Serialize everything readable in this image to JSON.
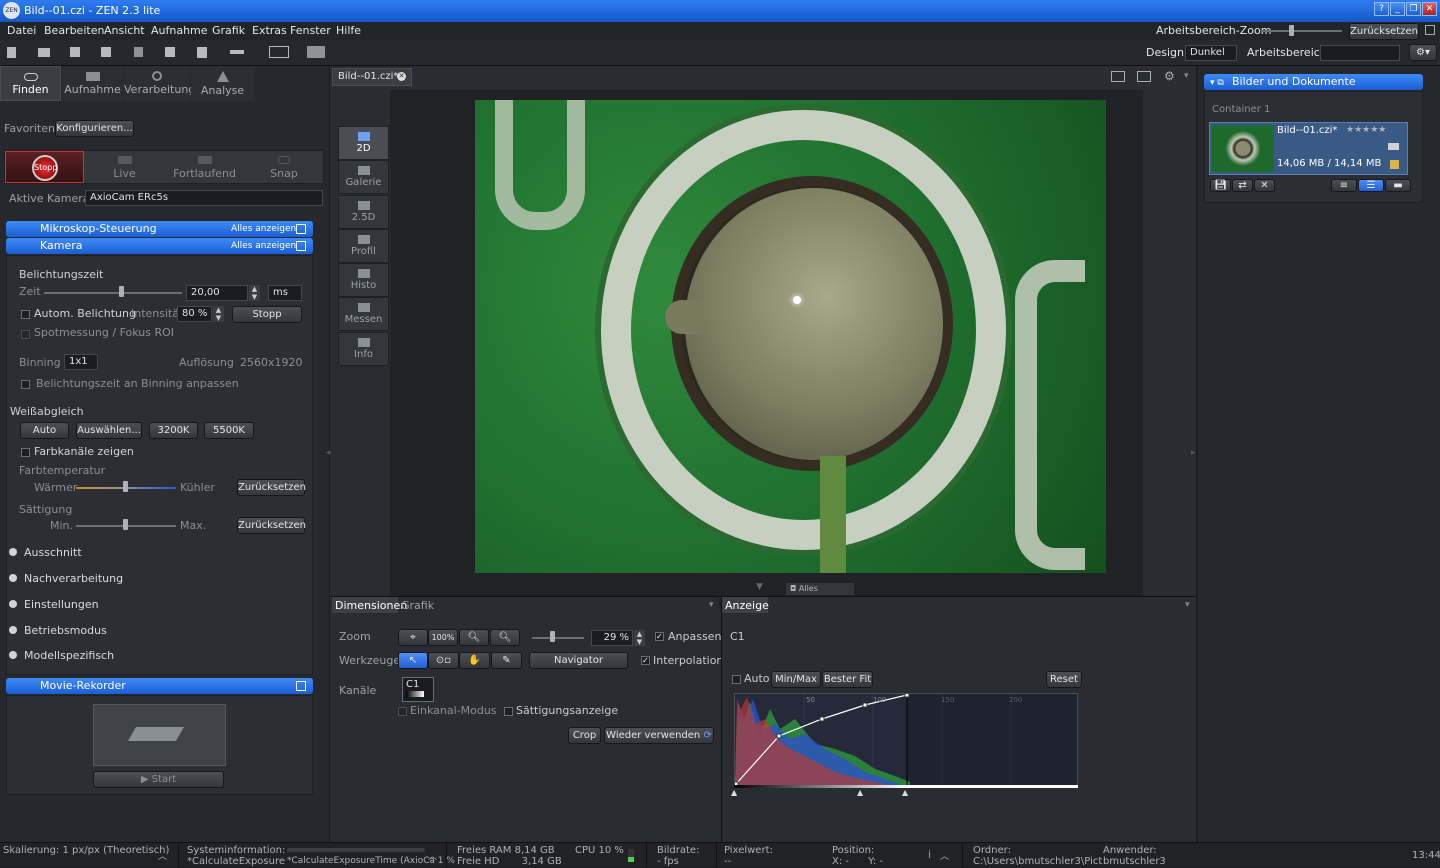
{
  "window": {
    "title": "Bild--01.czi - ZEN 2.3 lite"
  },
  "menu": [
    "Datei",
    "Bearbeiten",
    "Ansicht",
    "Aufnahme",
    "Grafik",
    "Extras",
    "Fenster",
    "Hilfe"
  ],
  "workspace": {
    "zoom_label": "Arbeitsbereich-Zoom",
    "reset": "Zurücksetzen",
    "design_label": "Design",
    "design_value": "Dunkel",
    "workspace_label": "Arbeitsbereich"
  },
  "tabs": [
    "Finden",
    "Aufnahme",
    "Verarbeitung",
    "Analyse"
  ],
  "favorites": {
    "label": "Favoriten",
    "configure": "Konfigurieren..."
  },
  "acquire": {
    "stop": "Stopp",
    "live": "Live",
    "continuous": "Fortlaufend",
    "snap": "Snap"
  },
  "camera_select": {
    "label": "Aktive Kamera",
    "value": "AxioCam ERc5s"
  },
  "sections": {
    "microscope": "Mikroskop-Steuerung",
    "camera": "Kamera",
    "show_all": "Alles anzeigen",
    "movie": "Movie-Rekorder"
  },
  "exposure": {
    "title": "Belichtungszeit",
    "time_label": "Zeit",
    "time_value": "20,00",
    "unit": "ms",
    "auto": "Autom. Belichtung",
    "intensity_label": "Intensität",
    "intensity_value": "80 %",
    "stop": "Stopp",
    "spot": "Spotmessung / Fokus ROI"
  },
  "binning": {
    "label": "Binning",
    "value": "1x1",
    "resolution_label": "Auflösung",
    "resolution_value": "2560x1920",
    "adapt": "Belichtungszeit an Binning anpassen"
  },
  "whitebalance": {
    "title": "Weißabgleich",
    "auto": "Auto",
    "choose": "Auswählen...",
    "k3200": "3200K",
    "k5500": "5500K",
    "show_channels": "Farbkanäle zeigen",
    "temp_label": "Farbtemperatur",
    "warmer": "Wärmer",
    "cooler": "Kühler",
    "reset": "Zurücksetzen",
    "saturation": "Sättigung",
    "min": "Min.",
    "max": "Max."
  },
  "collapsed": [
    "Ausschnitt",
    "Nachverarbeitung",
    "Einstellungen",
    "Betriebsmodus",
    "Modellspezifisch"
  ],
  "movie": {
    "start": "Start"
  },
  "doc_tab": "Bild--01.czi*",
  "view_tabs": [
    "2D",
    "Galerie",
    "2.5D",
    "Profil",
    "Histo",
    "Messen",
    "Info"
  ],
  "show_all_bottom": "Alles anzeigen",
  "dims": {
    "tab1": "Dimensionen",
    "tab2": "Grafik",
    "zoom": "Zoom",
    "zoom_100": "100%",
    "zoom_value": "29 %",
    "fit": "Anpassen",
    "tools": "Werkzeuge",
    "navigator": "Navigator",
    "interpolation": "Interpolation",
    "channels": "Kanäle",
    "channel": "C1",
    "single": "Einkanal-Modus",
    "saturation": "Sättigungsanzeige",
    "crop": "Crop",
    "reuse": "Wieder verwenden"
  },
  "display": {
    "tab": "Anzeige",
    "channel": "C1",
    "auto": "Auto",
    "minmax": "Min/Max",
    "bestfit": "Bester Fit",
    "reset": "Reset",
    "ticks": [
      "50",
      "100",
      "150",
      "200"
    ]
  },
  "docs": {
    "title": "Bilder und Dokumente",
    "container": "Container 1",
    "name": "Bild--01.czi*",
    "size": "14,06 MB / 14,14 MB",
    "stars": "★★★★★"
  },
  "status": {
    "scale": "Skalierung:  1 px/px (Theoretisch)",
    "sysinfo": "Systeminformation:",
    "sysinfo_val": "*CalculateExposure",
    "progress": "*CalculateExposureTime (AxioCa 1 %",
    "ram": "Freies RAM 8,14 GB",
    "hd": "Freie HD       3,14 GB",
    "cpu": "CPU 10 %",
    "fps": "Bildrate:",
    "fps_val": "- fps",
    "pixel": "Pixelwert:",
    "pixel_val": "--",
    "pos": "Position:",
    "pos_val": "X: -      Y: -",
    "folder": "Ordner:",
    "folder_val": "C:\\Users\\bmutschler3\\Pict",
    "user": "Anwender:",
    "user_val": "bmutschler3",
    "time": "13:44"
  },
  "colors": {
    "accent": "#2a72e8",
    "bg": "#26282e",
    "histo_red": "#c0392b",
    "histo_green": "#2e9e3e",
    "histo_blue": "#2f4fd0"
  }
}
